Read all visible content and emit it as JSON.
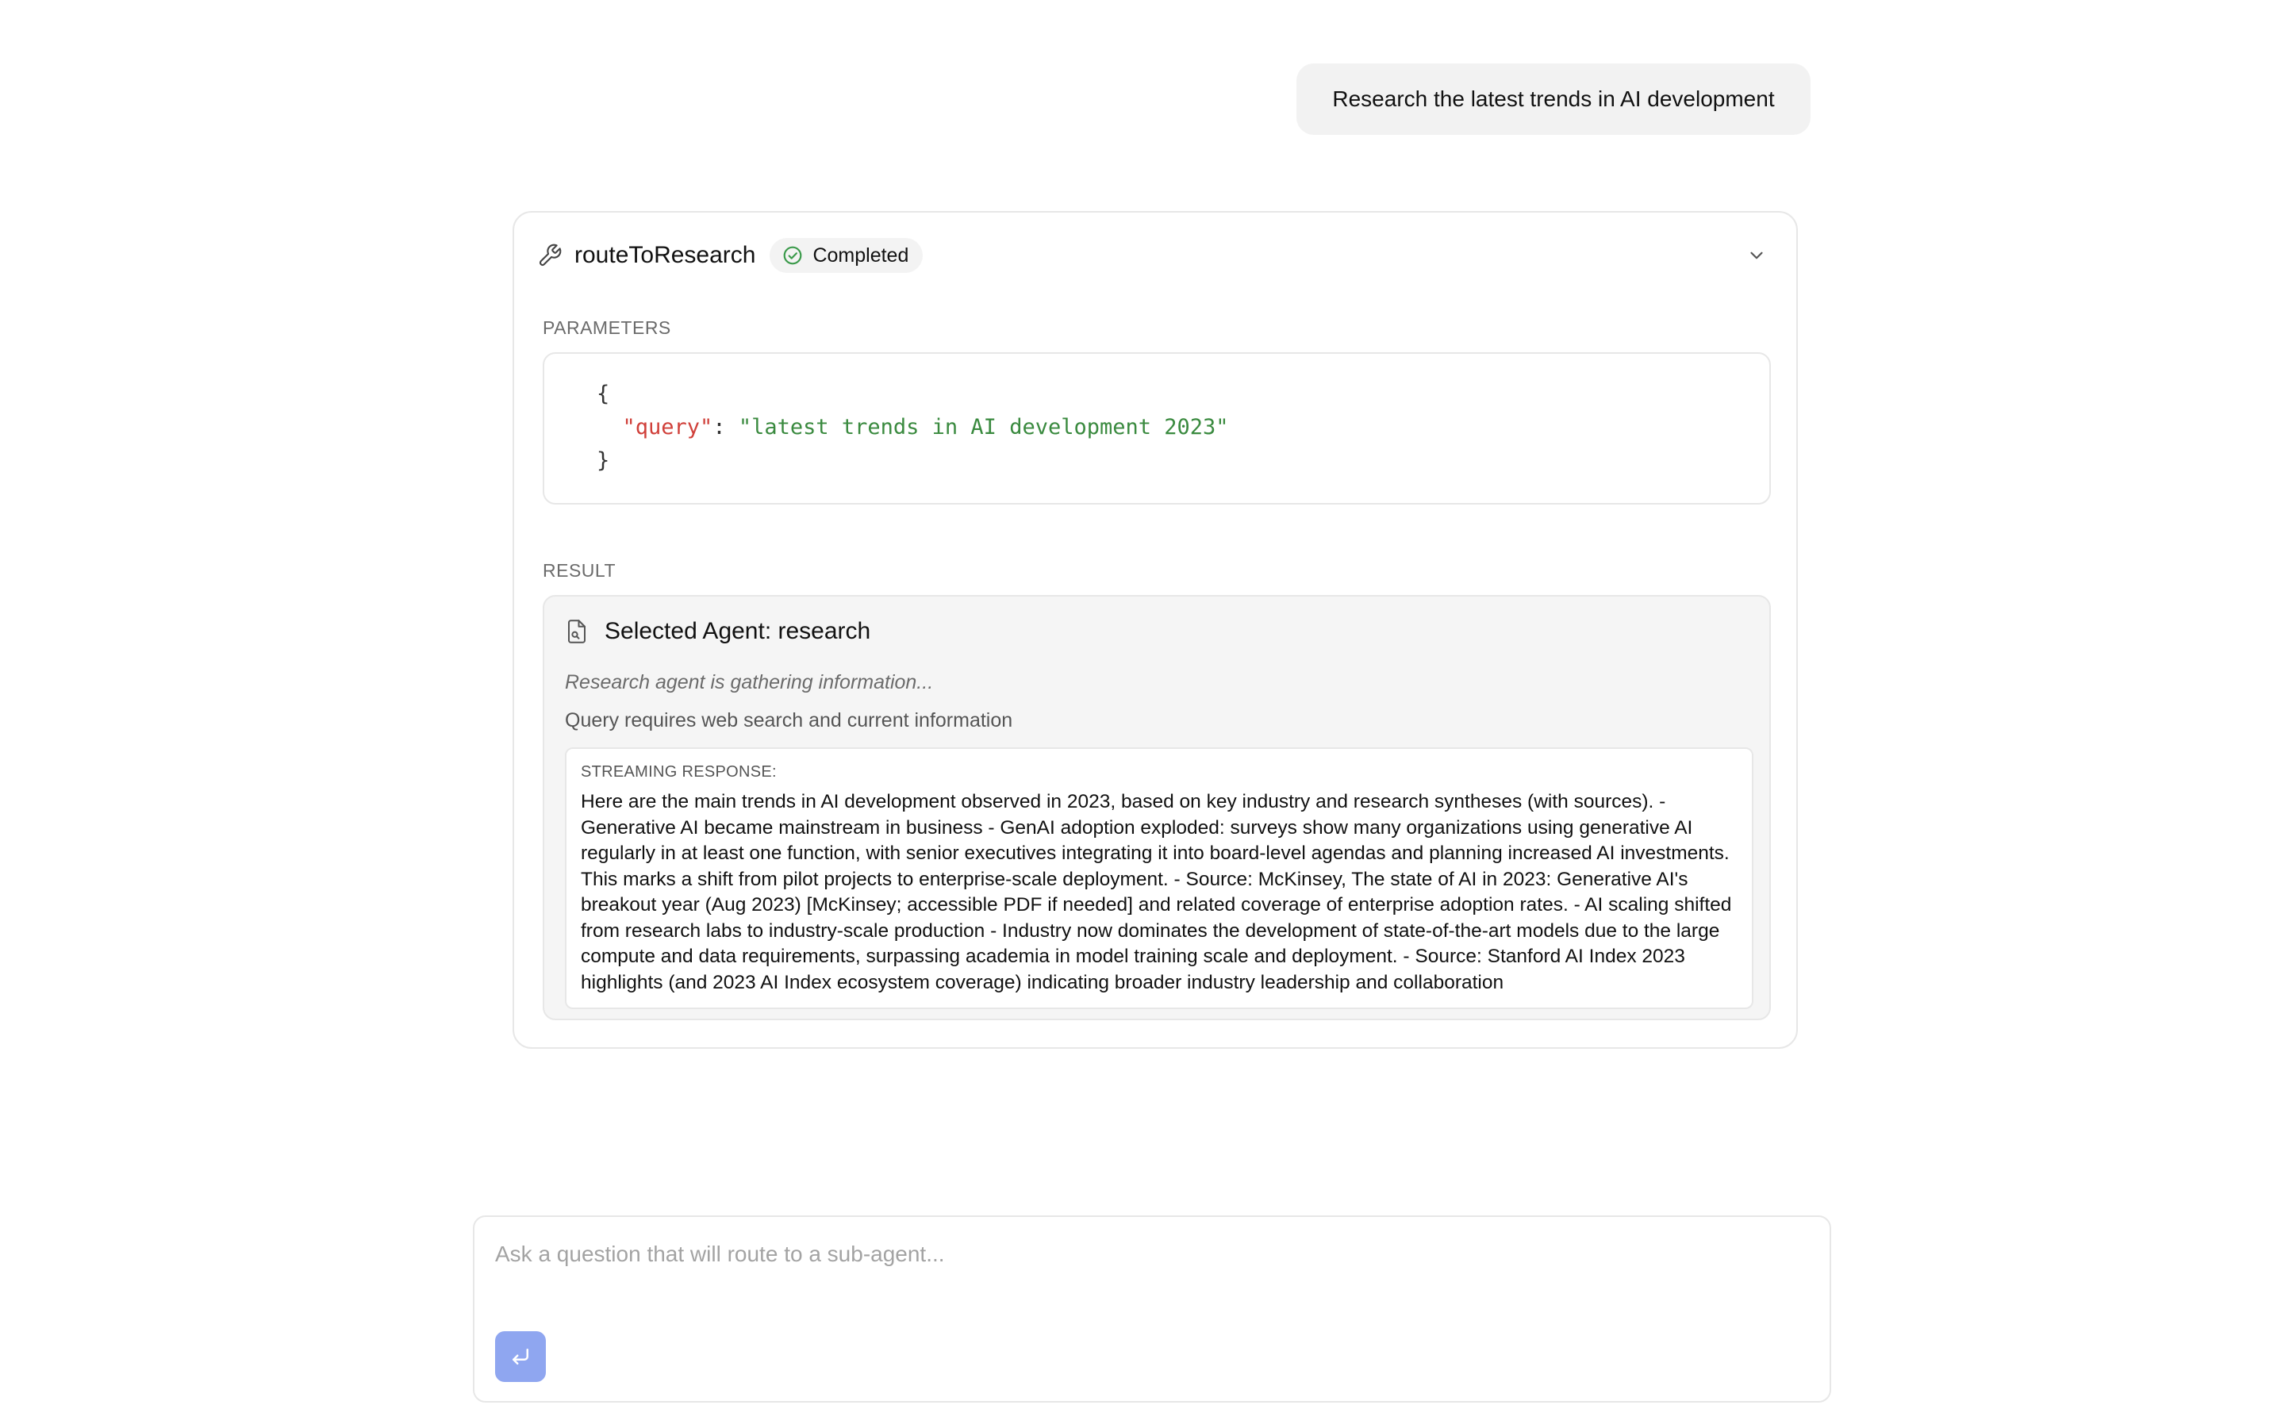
{
  "user_message": {
    "text": "Research the latest trends in AI development"
  },
  "tool_call": {
    "name": "routeToResearch",
    "status": "Completed",
    "status_color": "#3a9a4a",
    "parameters_label": "PARAMETERS",
    "parameters": {
      "open_brace": "{",
      "key": "\"query\"",
      "separator": ": ",
      "value": "\"latest trends in AI development 2023\"",
      "close_brace": "}"
    },
    "result_label": "RESULT",
    "result": {
      "agent_title": "Selected Agent: research",
      "agent_status": "Research agent is gathering information...",
      "reason": "Query requires web search and current information",
      "stream_label": "STREAMING RESPONSE:",
      "stream_text": "Here are the main trends in AI development observed in 2023, based on key industry and research syntheses (with sources). - Generative AI became mainstream in business - GenAI adoption exploded: surveys show many organizations using generative AI regularly in at least one function, with senior executives integrating it into board-level agendas and planning increased AI investments. This marks a shift from pilot projects to enterprise-scale deployment. - Source: McKinsey, The state of AI in 2023: Generative AI's breakout year (Aug 2023) [McKinsey; accessible PDF if needed] and related coverage of enterprise adoption rates. - AI scaling shifted from research labs to industry-scale production - Industry now dominates the development of state-of-the-art models due to the large compute and data requirements, surpassing academia in model training scale and deployment. - Source: Stanford AI Index 2023 highlights (and 2023 AI Index ecosystem coverage) indicating broader industry leadership and collaboration"
    }
  },
  "composer": {
    "placeholder": "Ask a question that will route to a sub-agent...",
    "value": "",
    "send_icon": "enter-return-icon",
    "send_color": "#8fa6f0"
  },
  "icons": {
    "tool": "wrench-icon",
    "status": "check-circle-icon",
    "toggle": "chevron-down-icon",
    "result": "document-search-icon"
  }
}
